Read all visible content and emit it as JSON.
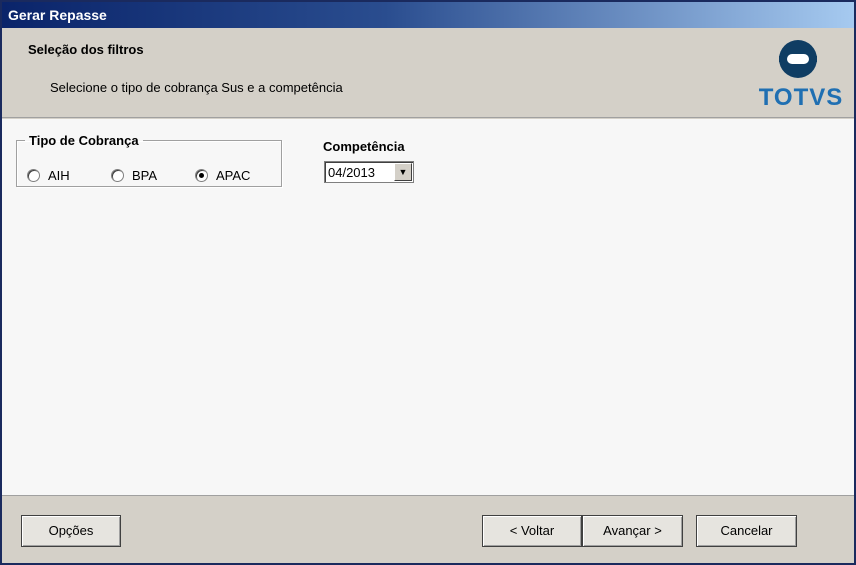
{
  "window": {
    "title": "Gerar Repasse"
  },
  "header": {
    "title": "Seleção dos filtros",
    "subtitle": "Selecione o tipo de cobrança Sus e a competência",
    "logo_text": "TOTVS"
  },
  "filters": {
    "group_label": "Tipo de Cobrança",
    "options": [
      {
        "label": "AIH",
        "selected": false
      },
      {
        "label": "BPA",
        "selected": false
      },
      {
        "label": "APAC",
        "selected": true
      }
    ],
    "competencia_label": "Competência",
    "competencia_value": "04/2013"
  },
  "footer": {
    "options_label": "Opções",
    "back_label": "< Voltar",
    "next_label": "Avançar >",
    "cancel_label": "Cancelar"
  },
  "colors": {
    "titlebar": "#0a246a",
    "logo_blue": "#1f6fb2",
    "logo_dark": "#0f3d63"
  },
  "icons": {
    "combo_arrow": "chevron-down-icon",
    "logo": "totvs-logo-icon"
  }
}
